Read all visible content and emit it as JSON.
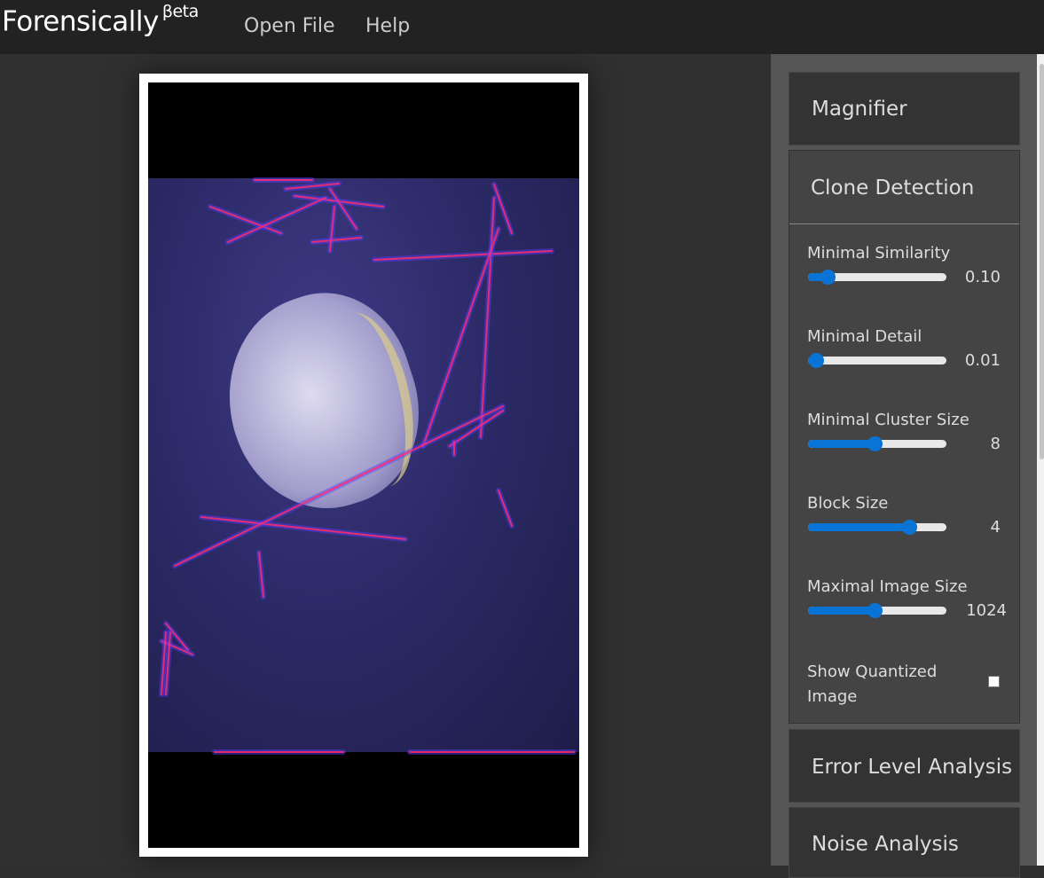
{
  "app": {
    "name": "Forensically",
    "badge": "βeta"
  },
  "nav": {
    "open_file": "Open File",
    "help": "Help"
  },
  "panels": {
    "magnifier": "Magnifier",
    "clone_detection": "Clone Detection",
    "error_level": "Error Level Analysis",
    "noise": "Noise Analysis"
  },
  "controls": [
    {
      "label": "Minimal Similarity",
      "value": "0.10",
      "fraction": 0.14
    },
    {
      "label": "Minimal Detail",
      "value": "0.01",
      "fraction": 0.06
    },
    {
      "label": "Minimal Cluster Size",
      "value": "8",
      "fraction": 0.48
    },
    {
      "label": "Block Size",
      "value": "4",
      "fraction": 0.73
    },
    {
      "label": "Maximal Image Size",
      "value": "1024",
      "fraction": 0.48
    }
  ],
  "show_quantized": {
    "label": "Show Quantized Image",
    "checked": false
  },
  "colors": {
    "accent": "#0a74d6",
    "match_line": "#ff2d6a",
    "match_glow": "#5a3cff"
  }
}
